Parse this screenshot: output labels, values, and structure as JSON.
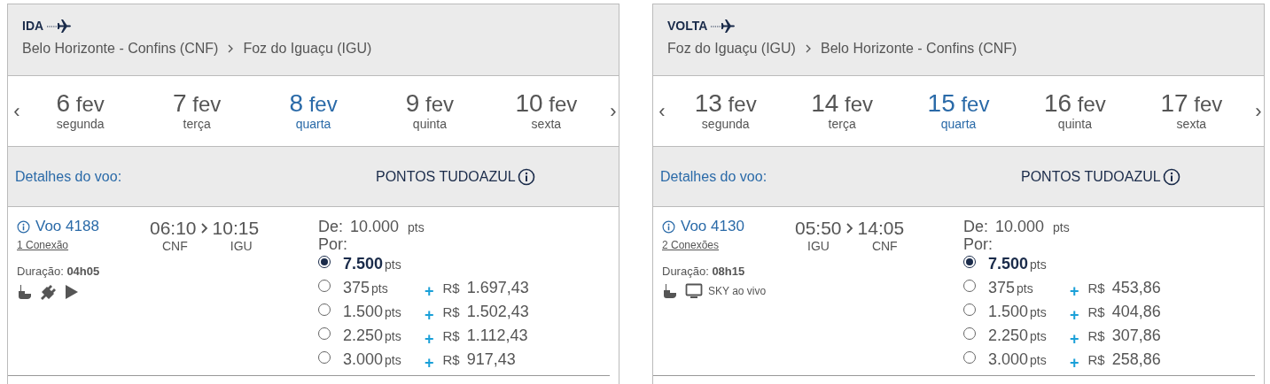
{
  "panels": [
    {
      "direction": "IDA",
      "origin": "Belo Horizonte - Confins (CNF)",
      "destination": "Foz do Iguaçu (IGU)",
      "prev": "‹",
      "next": "›",
      "dates": [
        {
          "day": "6",
          "month": "fev",
          "weekday": "segunda",
          "selected": false
        },
        {
          "day": "7",
          "month": "fev",
          "weekday": "terça",
          "selected": false
        },
        {
          "day": "8",
          "month": "fev",
          "weekday": "quarta",
          "selected": true
        },
        {
          "day": "9",
          "month": "fev",
          "weekday": "quinta",
          "selected": false
        },
        {
          "day": "10",
          "month": "fev",
          "weekday": "sexta",
          "selected": false
        }
      ],
      "details_label": "Detalhes do voo:",
      "points_label": "PONTOS TUDOAZUL",
      "flight": {
        "number": "Voo 4188",
        "connections": "1 Conexão",
        "departure": "06:10",
        "arrival": "10:15",
        "from": "CNF",
        "to": "IGU",
        "duration_label": "Duração:",
        "duration": "04h05",
        "amenities": [
          {
            "kind": "meal"
          },
          {
            "kind": "power"
          },
          {
            "kind": "video"
          }
        ],
        "from_label": "De:",
        "from_points": "10.000",
        "from_unit": "pts",
        "for_label": "Por:",
        "options": [
          {
            "points": "7.500",
            "unit": "pts",
            "selected": true
          },
          {
            "points": "375",
            "unit": "pts",
            "plus": "+",
            "currency": "R$",
            "amount": "1.697,43",
            "selected": false
          },
          {
            "points": "1.500",
            "unit": "pts",
            "plus": "+",
            "currency": "R$",
            "amount": "1.502,43",
            "selected": false
          },
          {
            "points": "2.250",
            "unit": "pts",
            "plus": "+",
            "currency": "R$",
            "amount": "1.112,43",
            "selected": false
          },
          {
            "points": "3.000",
            "unit": "pts",
            "plus": "+",
            "currency": "R$",
            "amount": "917,43",
            "selected": false
          }
        ]
      }
    },
    {
      "direction": "VOLTA",
      "origin": "Foz do Iguaçu (IGU)",
      "destination": "Belo Horizonte - Confins (CNF)",
      "prev": "‹",
      "next": "›",
      "dates": [
        {
          "day": "13",
          "month": "fev",
          "weekday": "segunda",
          "selected": false
        },
        {
          "day": "14",
          "month": "fev",
          "weekday": "terça",
          "selected": false
        },
        {
          "day": "15",
          "month": "fev",
          "weekday": "quarta",
          "selected": true
        },
        {
          "day": "16",
          "month": "fev",
          "weekday": "quinta",
          "selected": false
        },
        {
          "day": "17",
          "month": "fev",
          "weekday": "sexta",
          "selected": false
        }
      ],
      "details_label": "Detalhes do voo:",
      "points_label": "PONTOS TUDOAZUL",
      "flight": {
        "number": "Voo 4130",
        "connections": "2 Conexões",
        "departure": "05:50",
        "arrival": "14:05",
        "from": "IGU",
        "to": "CNF",
        "duration_label": "Duração:",
        "duration": "08h15",
        "amenities": [
          {
            "kind": "meal"
          },
          {
            "kind": "tv",
            "label": "SKY ao vivo"
          }
        ],
        "from_label": "De:",
        "from_points": "10.000",
        "from_unit": "pts",
        "for_label": "Por:",
        "options": [
          {
            "points": "7.500",
            "unit": "pts",
            "selected": true
          },
          {
            "points": "375",
            "unit": "pts",
            "plus": "+",
            "currency": "R$",
            "amount": "453,86",
            "selected": false
          },
          {
            "points": "1.500",
            "unit": "pts",
            "plus": "+",
            "currency": "R$",
            "amount": "404,86",
            "selected": false
          },
          {
            "points": "2.250",
            "unit": "pts",
            "plus": "+",
            "currency": "R$",
            "amount": "307,86",
            "selected": false
          },
          {
            "points": "3.000",
            "unit": "pts",
            "plus": "+",
            "currency": "R$",
            "amount": "258,86",
            "selected": false
          }
        ]
      }
    }
  ]
}
